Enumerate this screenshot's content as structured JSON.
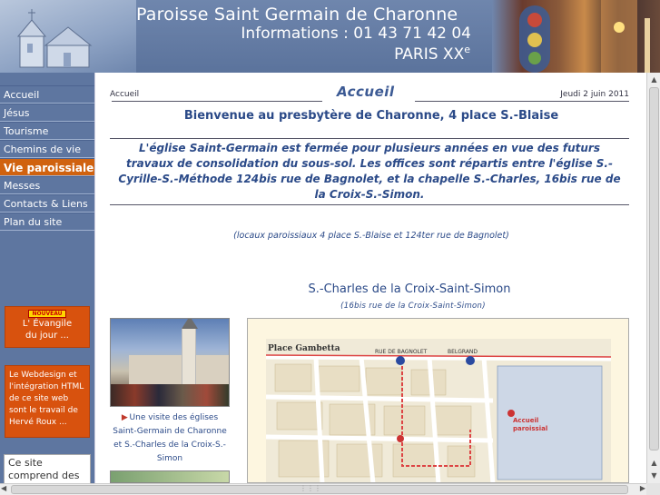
{
  "header": {
    "title": "Paroisse Saint Germain de Charonne",
    "phone": "Informations : 01 43 71 42 04",
    "city": "PARIS XX",
    "city_sup": "e"
  },
  "nav": [
    {
      "label": "Accueil",
      "active": false
    },
    {
      "label": "Jésus",
      "active": false
    },
    {
      "label": "Tourisme",
      "active": false
    },
    {
      "label": "Chemins de vie",
      "active": false
    },
    {
      "label": "Vie paroissiale",
      "active": true
    },
    {
      "label": "Messes",
      "active": false
    },
    {
      "label": "Contacts & Liens",
      "active": false
    },
    {
      "label": "Plan du site",
      "active": false
    }
  ],
  "sidebar": {
    "promo_badge": "NOUVEAU",
    "promo_line1": "L' Évangile",
    "promo_line2": "du jour ...",
    "credit": "Le Webdesign et l'intégration HTML de ce site web sont le travail de Hervé Roux ...",
    "info": "Ce site comprend des"
  },
  "breadcrumb": {
    "link": "Accueil",
    "title": "Accueil",
    "date": "Jeudi 2 juin 2011"
  },
  "main": {
    "welcome": "Bienvenue au presbytère de Charonne, 4 place S.-Blaise",
    "notice": "L'église Saint-Germain est fermée pour plusieurs années en vue des futurs travaux de consolidation du sous-sol. Les offices sont répartis entre l'église S.-Cyrille-S.-Méthode 124bis rue de Bagnolet, et la chapelle S.-Charles, 16bis rue de la Croix-S.-Simon.",
    "locaux": "(locaux paroissiaux 4 place S.-Blaise et 124ter rue de Bagnolet)",
    "chapel_title": "S.-Charles de la Croix-Saint-Simon",
    "chapel_address": "(16bis rue de la Croix-Saint-Simon)",
    "visit_caption": "Une visite des églises Saint-Germain de Charonne et S.-Charles de la Croix-S.-Simon"
  },
  "map": {
    "labels": {
      "place_gambetta": "Place Gambetta",
      "rue_bagnolet": "RUE DE BAGNOLET",
      "accueil": "Accueil",
      "paroissial": "paroissial",
      "belgrand": "BELGRAND"
    }
  },
  "colors": {
    "nav_bg": "#5e76a0",
    "active_bg": "#d0620f",
    "title_blue": "#2b4a88"
  }
}
